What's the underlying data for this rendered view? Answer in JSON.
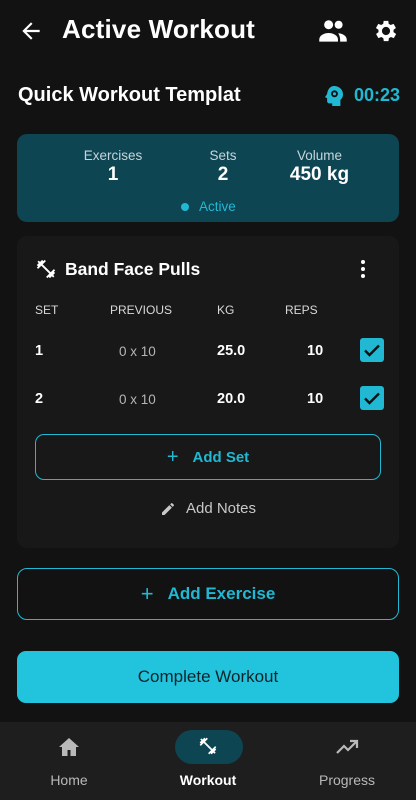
{
  "app_bar": {
    "title": "Active Workout",
    "back_icon": "arrow-left-icon",
    "people_icon": "people-icon",
    "settings_icon": "gear-icon"
  },
  "workout": {
    "name": "Quick Workout Templat",
    "timer_icon": "stopwatch-head-icon",
    "timer": "00:23"
  },
  "summary": {
    "exercises_label": "Exercises",
    "exercises_value": "1",
    "sets_label": "Sets",
    "sets_value": "2",
    "volume_label": "Volume",
    "volume_value": "450 kg",
    "status": "Active"
  },
  "exercise": {
    "name": "Band Face Pulls",
    "icon": "dumbbell-icon",
    "columns": {
      "set": "SET",
      "previous": "PREVIOUS",
      "kg": "KG",
      "reps": "REPS"
    },
    "rows": [
      {
        "set": "1",
        "previous": "0 x 10",
        "kg": "25.0",
        "reps": "10",
        "completed": true
      },
      {
        "set": "2",
        "previous": "0 x 10",
        "kg": "20.0",
        "reps": "10",
        "completed": true
      }
    ],
    "add_set_label": "Add Set",
    "add_notes_label": "Add Notes"
  },
  "actions": {
    "add_exercise_label": "Add Exercise",
    "complete_label": "Complete Workout"
  },
  "bottom_nav": {
    "items": [
      {
        "label": "Home",
        "icon": "home-icon",
        "selected": false
      },
      {
        "label": "Workout",
        "icon": "dumbbell-icon",
        "selected": true
      },
      {
        "label": "Progress",
        "icon": "trending-up-icon",
        "selected": false
      }
    ]
  },
  "colors": {
    "accent": "#21b8d3",
    "background": "#121212",
    "summary_bg": "#0e4553",
    "card_bg": "#181818",
    "nav_bg": "#1e1e1e"
  }
}
